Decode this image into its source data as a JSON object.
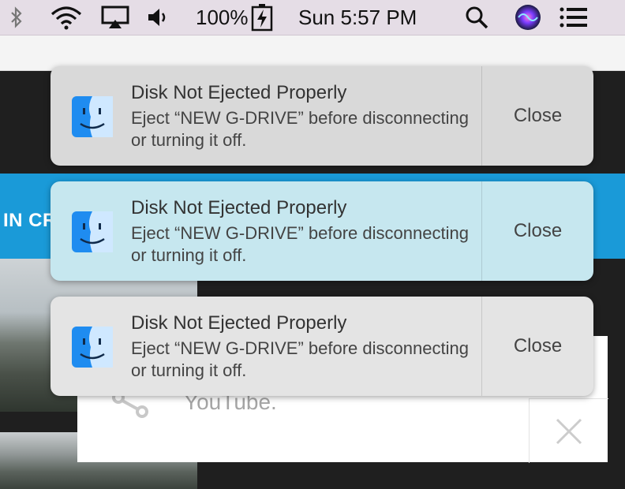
{
  "menubar": {
    "battery_text": "100%",
    "clock": "Sun 5:57 PM",
    "icons": [
      "bluetooth-icon",
      "wifi-icon",
      "airplay-icon",
      "volume-icon",
      "battery-charging-icon",
      "spotlight-search-icon",
      "siri-icon",
      "notification-center-icon"
    ]
  },
  "background": {
    "banner_text": "IN CR",
    "share_text": "YouTube."
  },
  "notifications": [
    {
      "title": "Disk Not Ejected Properly",
      "body": "Eject “NEW G-DRIVE” before disconnecting or turning it off.",
      "close_label": "Close",
      "icon": "finder-icon"
    },
    {
      "title": "Disk Not Ejected Properly",
      "body": "Eject “NEW G-DRIVE” before disconnecting or turning it off.",
      "close_label": "Close",
      "icon": "finder-icon"
    },
    {
      "title": "Disk Not Ejected Properly",
      "body": "Eject “NEW G-DRIVE” before disconnecting or turning it off.",
      "close_label": "Close",
      "icon": "finder-icon"
    }
  ]
}
